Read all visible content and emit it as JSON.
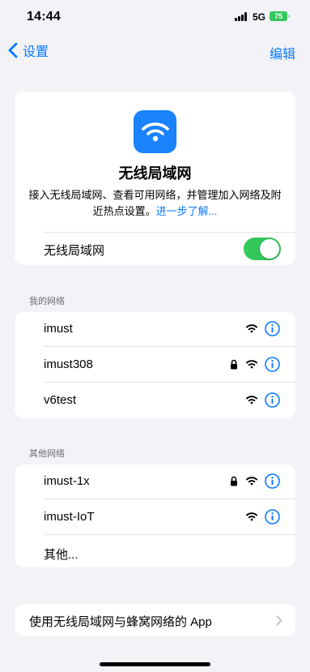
{
  "status_bar": {
    "time": "14:44",
    "network": "5G",
    "battery": "75"
  },
  "nav": {
    "back_label": "设置",
    "edit_label": "编辑"
  },
  "hero": {
    "title": "无线局域网",
    "description": "接入无线局域网、查看可用网络，并管理加入网络及附近热点设置。",
    "learn_more": "进一步了解...",
    "toggle_label": "无线局域网",
    "toggle_on": true
  },
  "my_networks": {
    "header": "我的网络",
    "items": [
      {
        "name": "imust",
        "locked": false
      },
      {
        "name": "imust308",
        "locked": true
      },
      {
        "name": "v6test",
        "locked": false
      }
    ]
  },
  "other_networks": {
    "header": "其他网络",
    "items": [
      {
        "name": "imust-1x",
        "locked": true
      },
      {
        "name": "imust-IoT",
        "locked": false
      }
    ],
    "other_label": "其他..."
  },
  "apps_row": {
    "label": "使用无线局域网与蜂窝网络的 App"
  },
  "colors": {
    "accent": "#0a7aff",
    "toggle_on": "#34c759",
    "background": "#f2f2f7"
  },
  "icons": {
    "back": "chevron-left-icon",
    "wifi": "wifi-icon",
    "lock": "lock-icon",
    "info": "info-icon",
    "chevron": "chevron-right-icon"
  }
}
